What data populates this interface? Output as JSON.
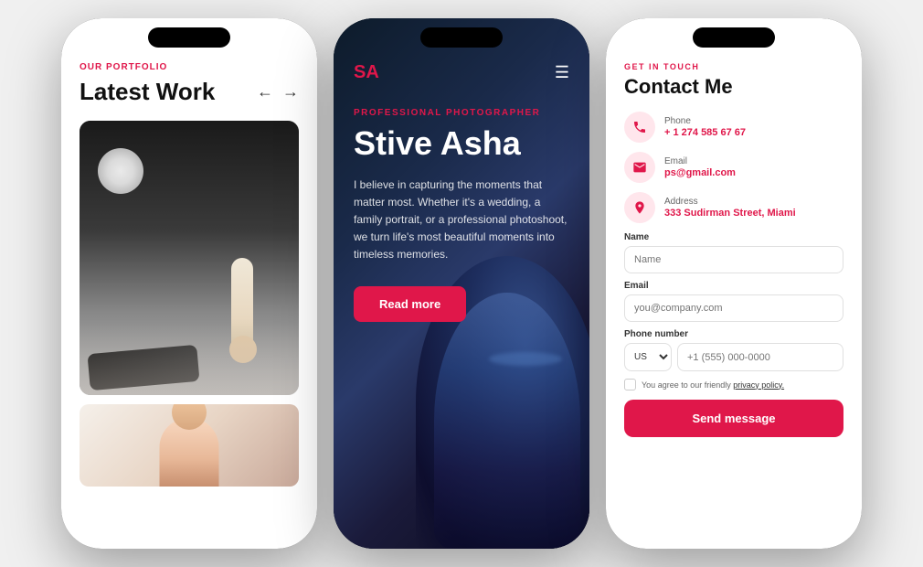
{
  "phone1": {
    "portfolio_label": "OUR PORTFOLIO",
    "title": "Latest Work",
    "arrow_left": "←",
    "arrow_right": "→"
  },
  "phone2": {
    "logo": "SA",
    "tag": "PROFESSIONAL PHOTOGRAPHER",
    "name": "Stive Asha",
    "description": "I believe in capturing the moments that matter most. Whether it's a wedding, a family portrait, or a professional photoshoot, we turn life's most beautiful moments into timeless memories.",
    "cta": "Read more"
  },
  "phone3": {
    "section_label": "GET IN TOUCH",
    "title": "Contact Me",
    "phone_label": "Phone",
    "phone_value": "+ 1 274 585 67 67",
    "email_label": "Email",
    "email_value": "ps@gmail.com",
    "address_label": "Address",
    "address_value": "333 Sudirman Street, Miami",
    "name_label": "Name",
    "name_placeholder": "Name",
    "email_field_label": "Email",
    "email_placeholder": "you@company.com",
    "phone_label2": "Phone number",
    "country_code": "US ∨",
    "phone_placeholder": "+1 (555) 000-0000",
    "privacy_text": "You agree to our friendly ",
    "privacy_link": "privacy policy.",
    "send_label": "Send message"
  }
}
